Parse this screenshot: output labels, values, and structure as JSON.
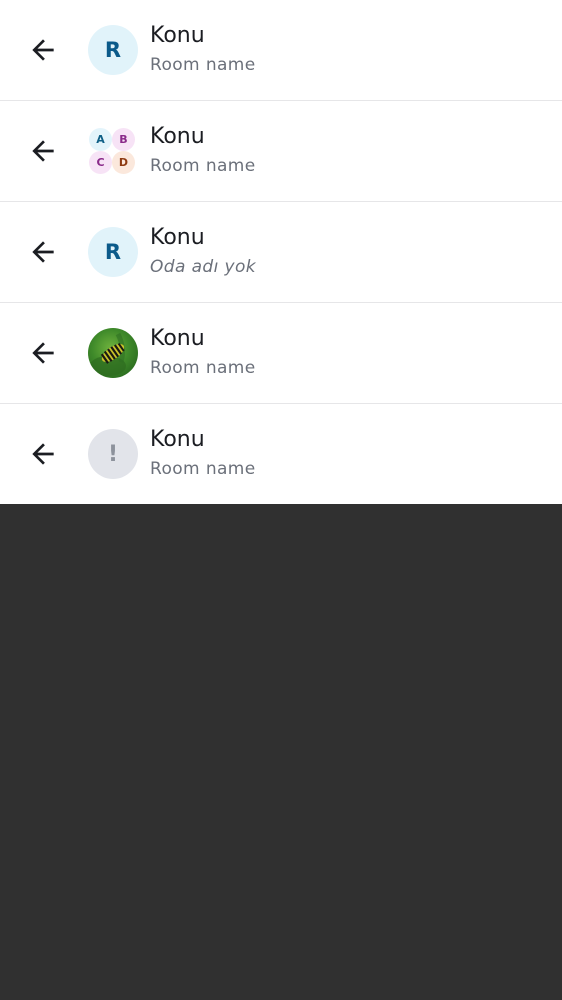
{
  "rows": [
    {
      "title": "Konu",
      "subtitle": "Room name",
      "avatar": {
        "type": "letter",
        "letter": "R"
      }
    },
    {
      "title": "Konu",
      "subtitle": "Room name",
      "avatar": {
        "type": "group",
        "letters": [
          "A",
          "B",
          "C",
          "D"
        ]
      }
    },
    {
      "title": "Konu",
      "subtitle": "Oda adı yok",
      "avatar": {
        "type": "letter",
        "letter": "R"
      }
    },
    {
      "title": "Konu",
      "subtitle": "Room name",
      "avatar": {
        "type": "image",
        "icon": "caterpillar-photo"
      }
    },
    {
      "title": "Konu",
      "subtitle": "Room name",
      "avatar": {
        "type": "warning",
        "letter": "!"
      }
    }
  ],
  "icons": {
    "back": "arrow-left-icon"
  },
  "colors": {
    "surface": "#ffffff",
    "backdrop": "#303030",
    "title_text": "#1b1d22",
    "subtitle_text": "#6b707a",
    "divider": "#e6e6e8",
    "avatar_letter_bg": "#e1f3fa",
    "avatar_letter_fg": "#0b5a8a",
    "avatar_warning_bg": "#e2e4ea"
  }
}
